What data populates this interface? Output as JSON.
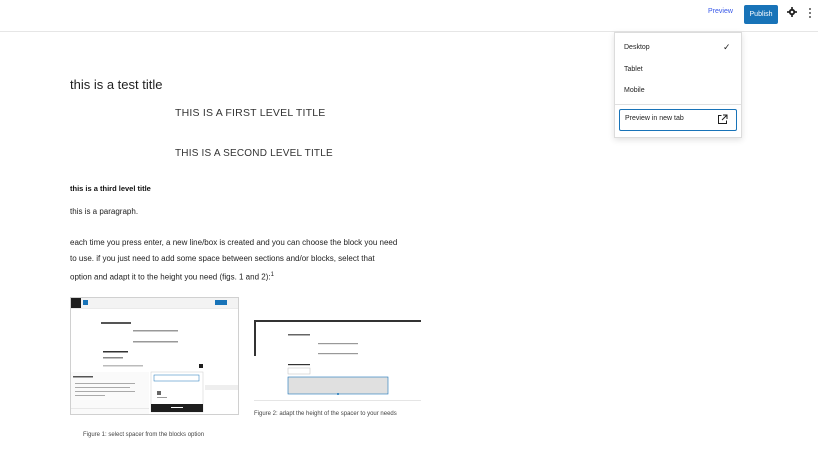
{
  "toolbar": {
    "preview_label": "Preview",
    "publish_label": "Publish",
    "accent": "#1873b8"
  },
  "preview_menu": {
    "items": [
      {
        "label": "Desktop",
        "checked": true
      },
      {
        "label": "Tablet",
        "checked": false
      },
      {
        "label": "Mobile",
        "checked": false
      }
    ],
    "check_glyph": "✓",
    "new_tab_label": "Preview in new tab"
  },
  "content": {
    "title": "this is a test title",
    "h1": "THIS IS A FIRST LEVEL TITLE",
    "h2": "THIS IS A SECOND LEVEL TITLE",
    "h3": "this is a third level title",
    "paragraph1": "this is a paragraph.",
    "paragraph2_line1": "each time you press enter, a new line/box is created and you can choose the block you need",
    "paragraph2_line2": "to use. if you just need to add some space between sections and/or blocks, select that",
    "paragraph2_line3": "option and adapt it to the height you need (figs. 1 and 2):",
    "footnote_ref": "1"
  },
  "figures": {
    "figure1_caption": "Figure 1: select spacer from the blocks option",
    "figure2_caption": "Figure 2: adapt the height of the spacer to your needs"
  }
}
